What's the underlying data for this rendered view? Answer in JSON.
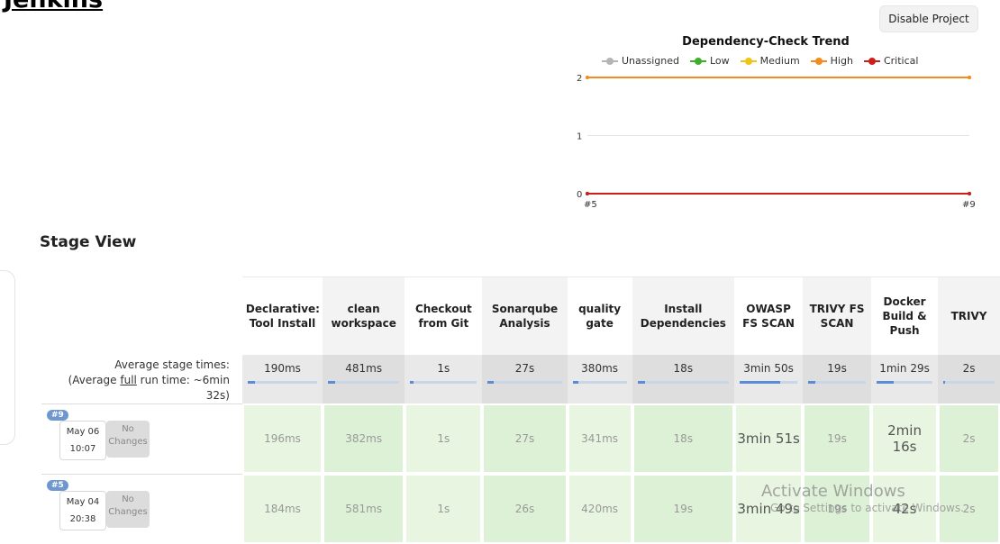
{
  "header": {
    "title": "Jenkins",
    "disable_button": "Disable Project"
  },
  "trend_chart": {
    "title": "Dependency-Check Trend",
    "legend": [
      {
        "label": "Unassigned",
        "color": "#b5b5b5"
      },
      {
        "label": "Low",
        "color": "#3fae2a"
      },
      {
        "label": "Medium",
        "color": "#f0c419"
      },
      {
        "label": "High",
        "color": "#f28c1e"
      },
      {
        "label": "Critical",
        "color": "#cc1f1a"
      }
    ],
    "y_ticks": [
      "2",
      "1",
      "0"
    ],
    "x_ticks": [
      "#5",
      "#9"
    ]
  },
  "chart_data": {
    "type": "line",
    "title": "Dependency-Check Trend",
    "x": [
      "#5",
      "#9"
    ],
    "ylim": [
      0,
      2
    ],
    "grid": true,
    "legend_position": "top",
    "series": [
      {
        "name": "Unassigned",
        "values": [
          0,
          0
        ]
      },
      {
        "name": "Low",
        "values": [
          0,
          0
        ]
      },
      {
        "name": "Medium",
        "values": [
          2,
          2
        ]
      },
      {
        "name": "High",
        "values": [
          2,
          2
        ]
      },
      {
        "name": "Critical",
        "values": [
          0,
          0
        ]
      }
    ]
  },
  "stage_view": {
    "title": "Stage View",
    "avg_label_line1": "Average stage times:",
    "avg_label_prefix": "(Average ",
    "avg_label_full": "full",
    "avg_label_suffix": " run time: ~6min 32s)",
    "stages": [
      {
        "name": "Declarative: Tool Install",
        "avg": "190ms",
        "bar": 0.1
      },
      {
        "name": "clean workspace",
        "avg": "481ms",
        "bar": 0.1
      },
      {
        "name": "Checkout from Git",
        "avg": "1s",
        "bar": 0.05
      },
      {
        "name": "Sonarqube Analysis",
        "avg": "27s",
        "bar": 0.08
      },
      {
        "name": "quality gate",
        "avg": "380ms",
        "bar": 0.1
      },
      {
        "name": "Install Dependencies",
        "avg": "18s",
        "bar": 0.08
      },
      {
        "name": "OWASP FS SCAN",
        "avg": "3min 50s",
        "bar": 0.7
      },
      {
        "name": "TRIVY FS SCAN",
        "avg": "19s",
        "bar": 0.12
      },
      {
        "name": "Docker Build & Push",
        "avg": "1min 29s",
        "bar": 0.3
      },
      {
        "name": "TRIVY",
        "avg": "2s",
        "bar": 0.04
      }
    ],
    "builds": [
      {
        "badge": "#9",
        "date": "May 06",
        "time": "10:07",
        "changes": "No Changes",
        "times": [
          "196ms",
          "382ms",
          "1s",
          "27s",
          "341ms",
          "18s",
          "3min 51s",
          "19s",
          "2min 16s",
          "2s"
        ]
      },
      {
        "badge": "#5",
        "date": "May 04",
        "time": "20:38",
        "changes": "No Changes",
        "times": [
          "184ms",
          "581ms",
          "1s",
          "26s",
          "420ms",
          "19s",
          "3min 49s",
          "19s",
          "42s",
          "2s"
        ]
      }
    ]
  },
  "watermark": {
    "title": "Activate Windows",
    "subtitle": "Go to Settings to activate Windows."
  }
}
